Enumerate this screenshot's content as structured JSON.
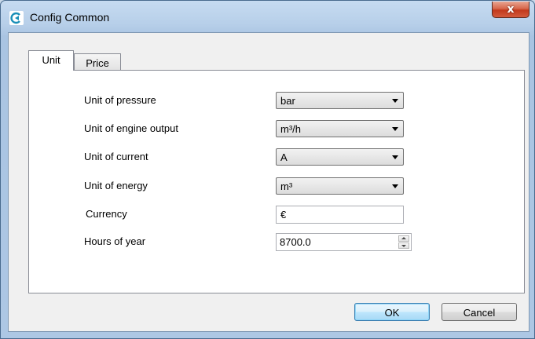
{
  "window": {
    "title": "Config Common",
    "close_glyph": "x"
  },
  "tabs": [
    {
      "label": "Unit",
      "active": true
    },
    {
      "label": "Price",
      "active": false
    }
  ],
  "fields": {
    "pressure": {
      "label": "Unit of pressure",
      "value": "bar"
    },
    "engine_output": {
      "label": "Unit of engine output",
      "value": "m³/h"
    },
    "current": {
      "label": "Unit of current",
      "value": "A"
    },
    "energy": {
      "label": "Unit of energy",
      "value": "m³"
    },
    "currency": {
      "label": "Currency",
      "value": "€"
    },
    "hours": {
      "label": "Hours of year",
      "value": "8700.0"
    }
  },
  "buttons": {
    "ok": "OK",
    "cancel": "Cancel"
  },
  "colors": {
    "accent": "#3c7fb1",
    "close": "#c2391c"
  }
}
